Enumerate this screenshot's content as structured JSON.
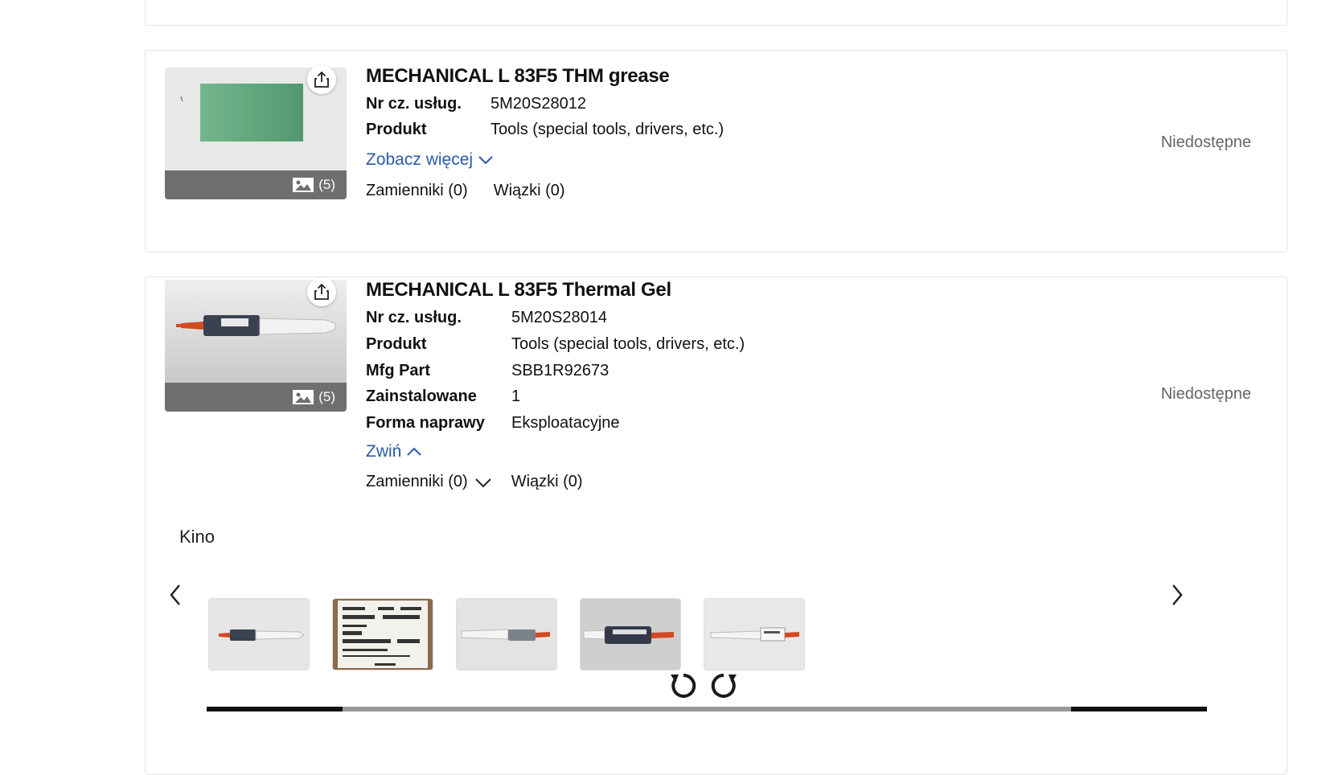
{
  "card1": {
    "title": "MECHANICAL L 83F5 THM grease",
    "image_count": "(5)",
    "fields": [
      {
        "label": "Nr cz. usług.",
        "value": "5M20S28012"
      },
      {
        "label": "Produkt",
        "value": "Tools (special tools, drivers, etc.)"
      }
    ],
    "see_more": "Zobacz więcej",
    "replacements": "Zamienniki (0)",
    "bundles": "Wiązki (0)",
    "status": "Niedostępne"
  },
  "card2": {
    "title": "MECHANICAL L 83F5 Thermal Gel",
    "image_count": "(5)",
    "fields": [
      {
        "label": "Nr cz. usług.",
        "value": "5M20S28014"
      },
      {
        "label": "Produkt",
        "value": "Tools (special tools, drivers, etc.)"
      },
      {
        "label": "Mfg Part",
        "value": "SBB1R92673"
      },
      {
        "label": "Zainstalowane",
        "value": "1"
      },
      {
        "label": "Forma naprawy",
        "value": "Eksploatacyjne"
      }
    ],
    "collapse": "Zwiń",
    "replacements": "Zamienniki (0)",
    "bundles": "Wiązki (0)",
    "status": "Niedostępne",
    "gallery_label": "Kino",
    "thumbnail_count": 5
  },
  "colors": {
    "link": "#2a5aa8",
    "status": "#666666",
    "image_bar": "#6f6f6f"
  },
  "icons": [
    "share-icon",
    "image-icon",
    "chevron-down-icon",
    "chevron-up-icon",
    "chevron-left-icon",
    "chevron-right-icon",
    "rotate-left-icon",
    "rotate-right-icon"
  ]
}
